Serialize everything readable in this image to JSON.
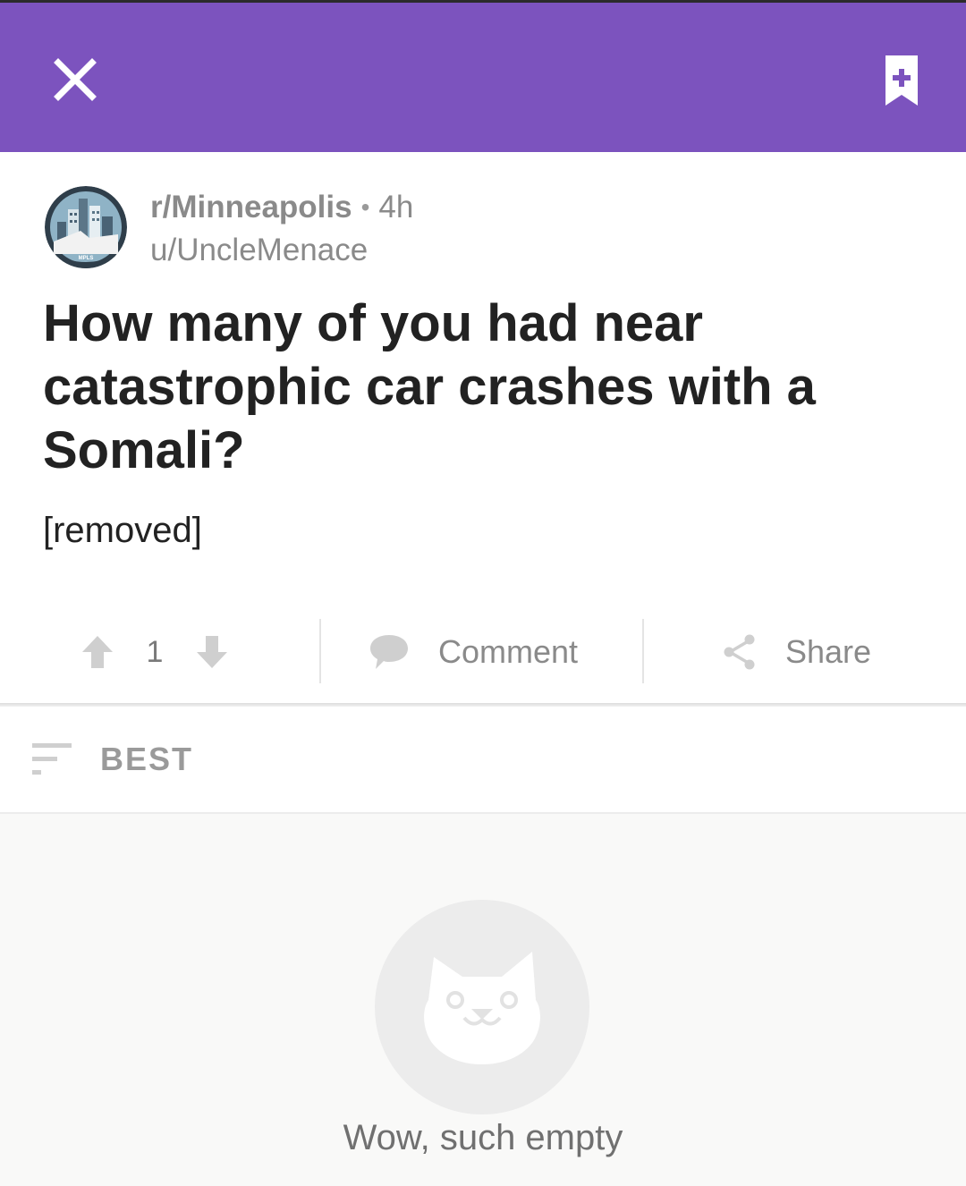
{
  "header": {
    "close_icon": "close-icon",
    "bookmark_icon": "bookmark-add-icon",
    "accent_color": "#7c53be"
  },
  "post": {
    "subreddit": "r/Minneapolis",
    "separator": "•",
    "age": "4h",
    "author": "u/UncleMenace",
    "title": "How many of you had near catastrophic car crashes with a Somali?",
    "body": "[removed]",
    "avatar_text": "MPLS"
  },
  "actions": {
    "score": "1",
    "comment_label": "Comment",
    "share_label": "Share"
  },
  "sort": {
    "label": "BEST"
  },
  "empty_state": {
    "text": "Wow, such empty"
  }
}
